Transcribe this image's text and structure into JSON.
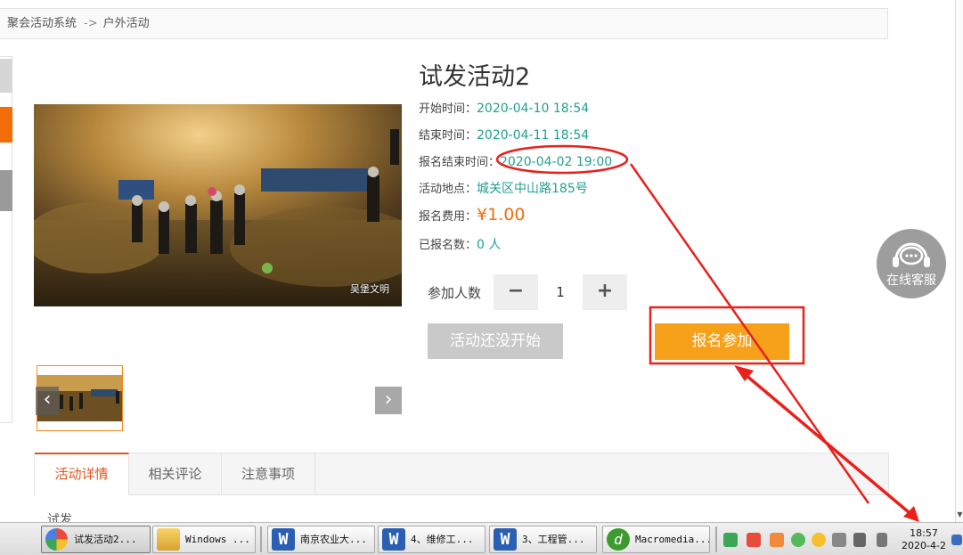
{
  "breadcrumb": {
    "root": "聚会活动系统",
    "separator": "->",
    "current": "户外活动"
  },
  "event": {
    "title": "试发活动2",
    "start_label": "开始时间：",
    "start_value": "2020-04-10 18:54",
    "end_label": "结束时间：",
    "end_value": "2020-04-11 18:54",
    "reg_end_label": "报名结束时间：",
    "reg_end_value": "2020-04-02 19:00",
    "location_label": "活动地点：",
    "location_value": "城关区中山路185号",
    "fee_label": "报名费用：",
    "fee_value": "¥1.00",
    "registered_label": "已报名数：",
    "registered_value": "0 人"
  },
  "image": {
    "watermark": "吴堡文明"
  },
  "quantity": {
    "label": "参加人数",
    "minus": "−",
    "value": "1",
    "plus": "+"
  },
  "buttons": {
    "not_started": "活动还没开始",
    "signup": "报名参加"
  },
  "chat": {
    "label": "在线客服"
  },
  "tabs": [
    {
      "label": "活动详情",
      "active": true
    },
    {
      "label": "相关评论",
      "active": false
    },
    {
      "label": "注意事项",
      "active": false
    }
  ],
  "detail": {
    "text": "试发"
  },
  "taskbar": {
    "items": [
      {
        "label": "试发活动2...",
        "icon": "browser-icon",
        "active": true
      },
      {
        "label": "Windows ...",
        "icon": "folder-icon",
        "active": false
      },
      {
        "label": "南京农业大...",
        "icon": "word-icon",
        "active": false
      },
      {
        "label": "4、维修工...",
        "icon": "word-icon",
        "active": false
      },
      {
        "label": "3、工程管...",
        "icon": "word-icon",
        "active": false
      },
      {
        "label": "Macromedia...",
        "icon": "dreamweaver-icon",
        "active": false
      }
    ],
    "clock_time": "18:57",
    "clock_date": "2020-4-2"
  },
  "colors": {
    "accent": "#e2541b",
    "teal": "#21a08f",
    "fee": "#f26d0a",
    "signup": "#f7a11a",
    "annotation": "#e8211c"
  }
}
